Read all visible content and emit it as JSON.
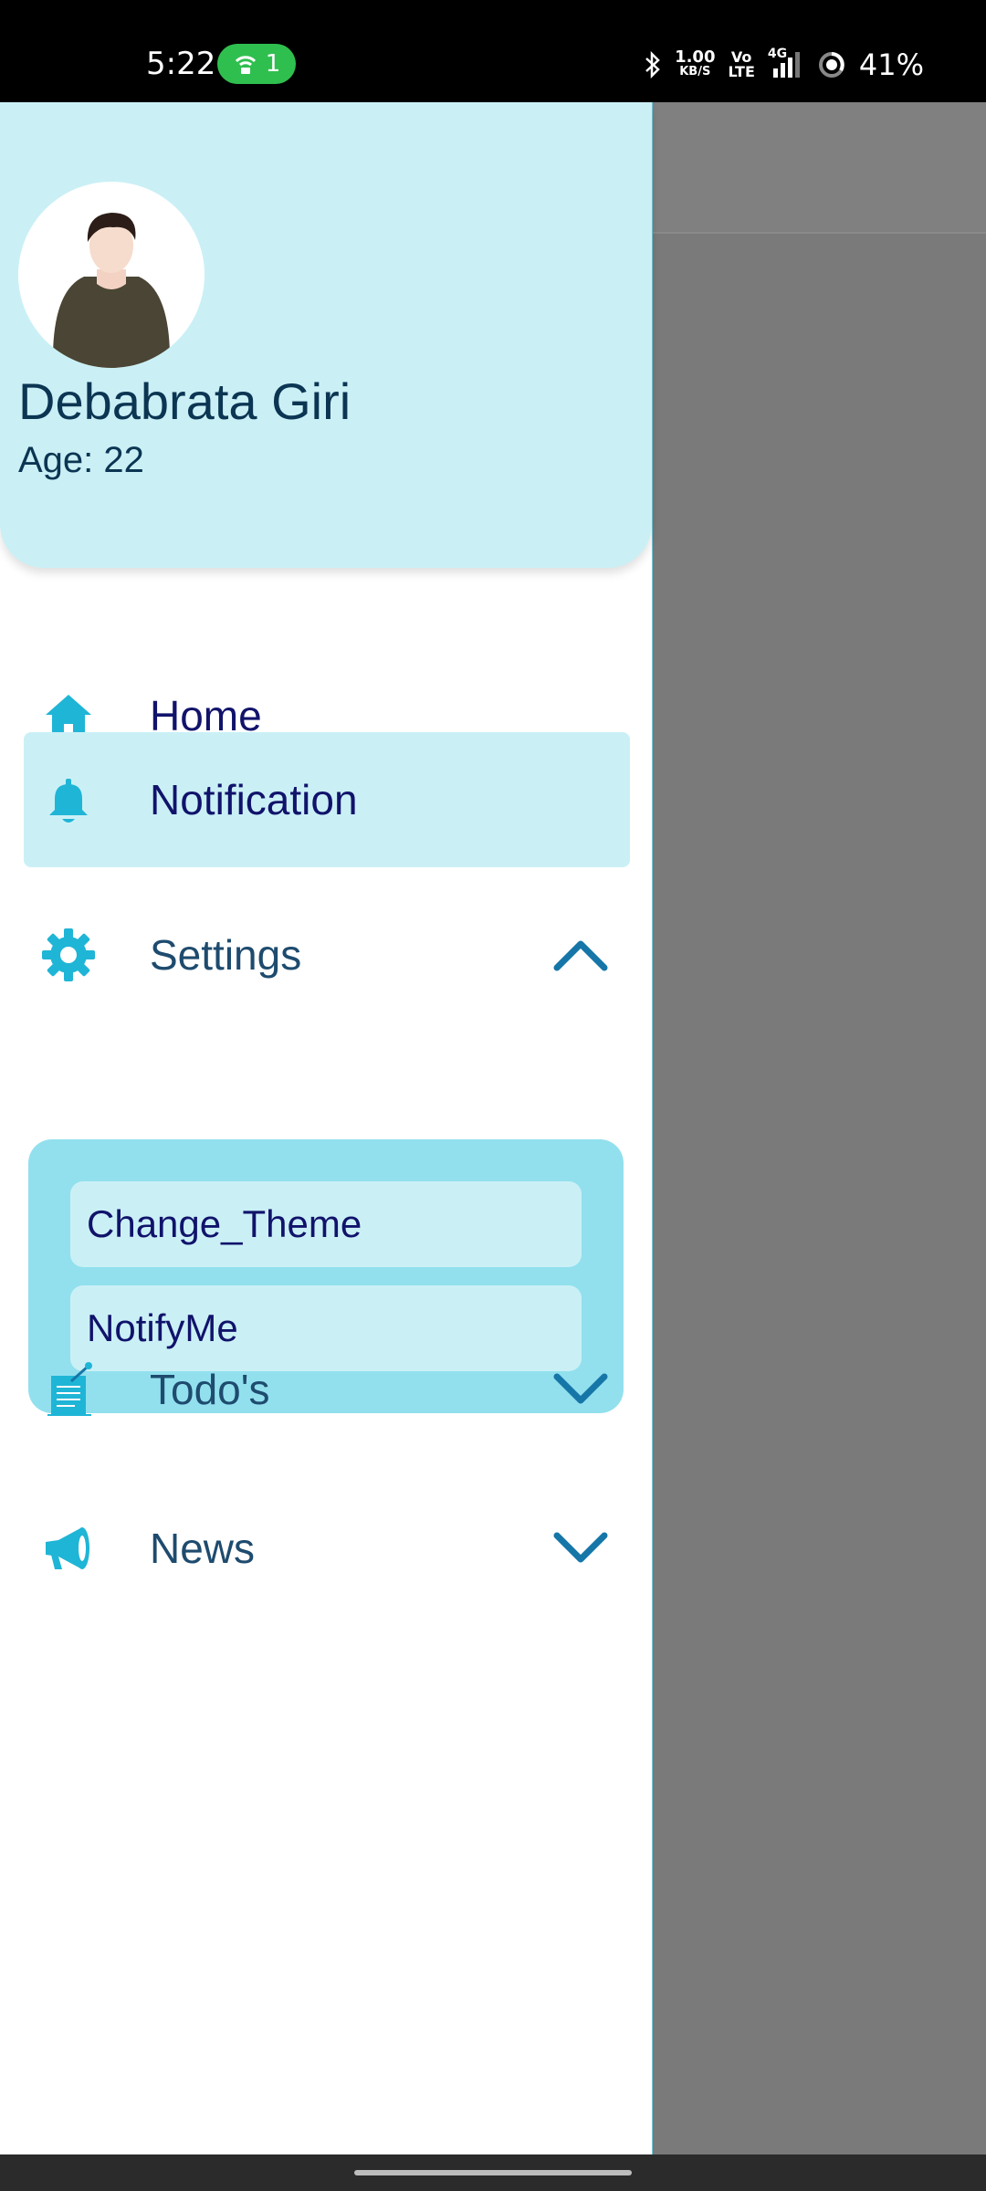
{
  "status_bar": {
    "time": "5:22",
    "hotspot_count": "1",
    "net_speed_value": "1.00",
    "net_speed_unit": "KB/S",
    "volte_top": "Vo",
    "volte_bottom": "LTE",
    "network": "4G",
    "battery": "41%"
  },
  "profile": {
    "name": "Debabrata Giri",
    "age": "Age: 22"
  },
  "nav": {
    "home": "Home",
    "notification": "Notification",
    "settings": "Settings",
    "settings_sub": [
      "Change_Theme",
      "NotifyMe"
    ],
    "todos": "Todo's",
    "news": "News"
  },
  "colors": {
    "accent": "#1fb5d6",
    "drawer_header": "#caf0f6",
    "submenu_bg": "#92e0ee",
    "text_dark": "#11136b"
  },
  "icons": {
    "home": "home-icon",
    "notification": "bell-icon",
    "settings": "gear-icon",
    "todos": "clipboard-pin-icon",
    "news": "megaphone-icon"
  }
}
